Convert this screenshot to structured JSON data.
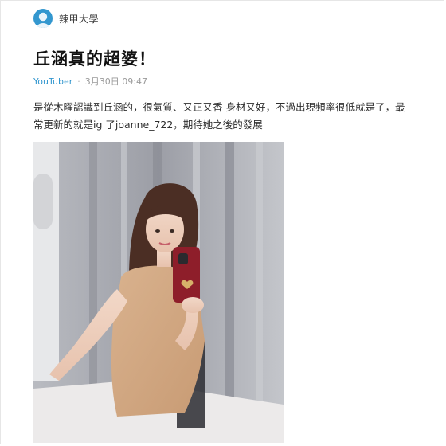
{
  "board": {
    "name": "辣甲大學",
    "icon": "board-avatar-icon",
    "icon_color": "#3397cf"
  },
  "post": {
    "title": "丘涵真的超婆！",
    "author": "YouTuber",
    "separator": "·",
    "timestamp": "3月30日 09:47",
    "body_line_1": "是從木曜認識到丘涵的，很氣質、又正又香 身材又好，不過出現頻率很低就是了，最",
    "body_line_2": "常更新的就是ig 了joanne_722，期待她之後的發展"
  },
  "photo": {
    "icon": "post-photo-image"
  },
  "colors": {
    "accent": "#3397cf",
    "title": "#111111",
    "meta": "#9a9a9a"
  }
}
